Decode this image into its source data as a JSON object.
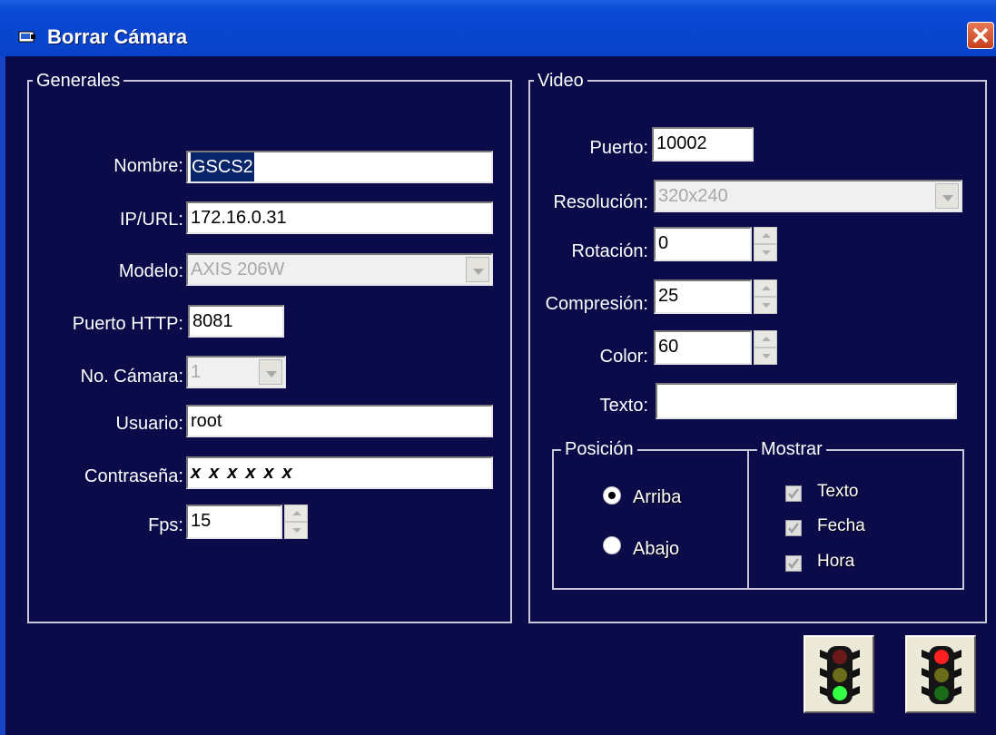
{
  "window": {
    "title": "Borrar Cámara"
  },
  "generales": {
    "legend": "Generales",
    "nombre_label": "Nombre:",
    "nombre_value": "GSCS2",
    "ip_label": "IP/URL:",
    "ip_value": "172.16.0.31",
    "modelo_label": "Modelo:",
    "modelo_value": "AXIS 206W",
    "puerto_label": "Puerto HTTP:",
    "puerto_value": "8081",
    "camara_label": "No. Cámara:",
    "camara_value": "1",
    "usuario_label": "Usuario:",
    "usuario_value": "root",
    "password_label": "Contraseña:",
    "password_value": "xxxxxx",
    "fps_label": "Fps:",
    "fps_value": "15"
  },
  "video": {
    "legend": "Video",
    "puerto_label": "Puerto:",
    "puerto_value": "10002",
    "resolucion_label": "Resolución:",
    "resolucion_value": "320x240",
    "rotacion_label": "Rotación:",
    "rotacion_value": "0",
    "compresion_label": "Compresión:",
    "compresion_value": "25",
    "color_label": "Color:",
    "color_value": "60",
    "texto_label": "Texto:",
    "texto_value": ""
  },
  "posicion": {
    "legend": "Posición",
    "options": [
      "Arriba",
      "Abajo"
    ],
    "selected": "Arriba"
  },
  "mostrar": {
    "legend": "Mostrar",
    "items": [
      {
        "label": "Texto",
        "checked": true
      },
      {
        "label": "Fecha",
        "checked": true
      },
      {
        "label": "Hora",
        "checked": true
      }
    ]
  },
  "buttons": {
    "start_icon": "traffic-light-green-icon",
    "stop_icon": "traffic-light-red-icon"
  },
  "colors": {
    "background": "#0b0b4a",
    "titlebar": "#0a4ad6",
    "close": "#d8552e"
  }
}
